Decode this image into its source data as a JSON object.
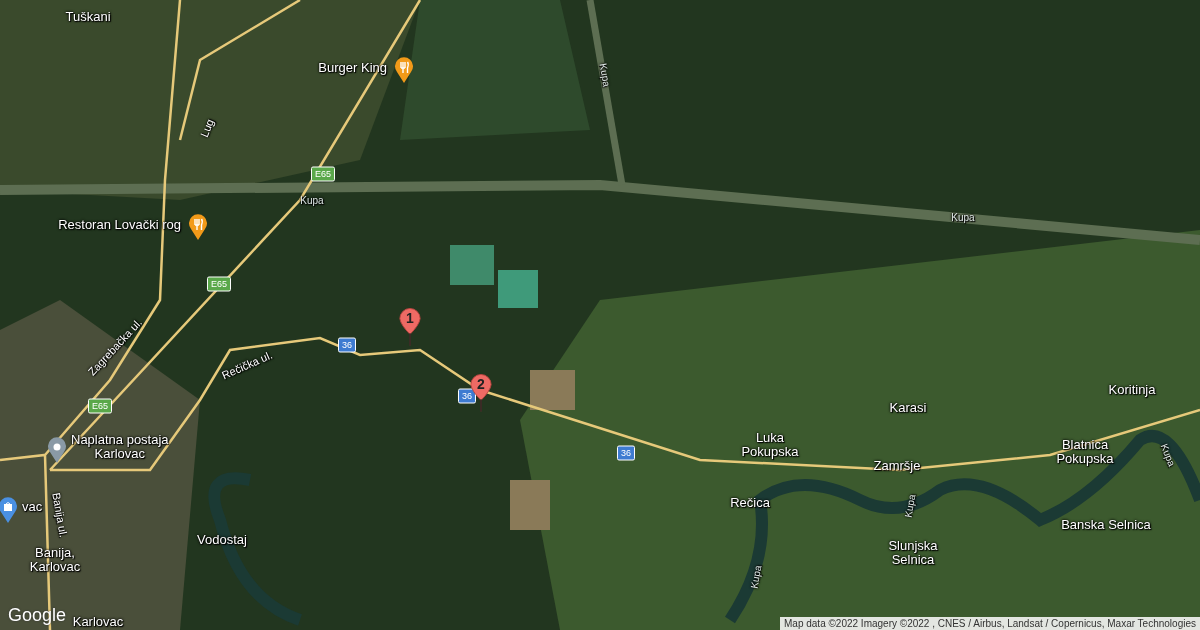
{
  "map": {
    "places": [
      {
        "kind": "town",
        "name": "Tuškani"
      },
      {
        "kind": "restaurant",
        "name": "Burger King"
      },
      {
        "kind": "restaurant",
        "name": "Restoran Lovački rog"
      },
      {
        "kind": "town",
        "name": "Koritinja"
      },
      {
        "kind": "town",
        "name": "Karasi"
      },
      {
        "kind": "landmark",
        "name": "Naplatna postaja\nKarlovac"
      },
      {
        "kind": "town",
        "name": "Luka\nPokupska"
      },
      {
        "kind": "town",
        "name": "Blatnica\nPokupska"
      },
      {
        "kind": "town",
        "name": "Zamršje"
      },
      {
        "kind": "town",
        "name": "Rečica"
      },
      {
        "kind": "shopping",
        "name": "vac"
      },
      {
        "kind": "town",
        "name": "Banska Selnica"
      },
      {
        "kind": "town",
        "name": "Vodostaj"
      },
      {
        "kind": "town",
        "name": "Slunjska\nSelnica"
      },
      {
        "kind": "town",
        "name": "Banija,\nKarlovac"
      },
      {
        "kind": "town",
        "name": "Karlovac"
      }
    ],
    "feature_labels": [
      {
        "kind": "river",
        "name": "Kupa"
      },
      {
        "kind": "river",
        "name": "Kupa"
      },
      {
        "kind": "river",
        "name": "Kupa"
      },
      {
        "kind": "river",
        "name": "Kupa"
      },
      {
        "kind": "river",
        "name": "Kupa"
      },
      {
        "kind": "river",
        "name": "Kupa"
      },
      {
        "kind": "street",
        "name": "Lug"
      },
      {
        "kind": "street",
        "name": "Zagrebačka ul."
      },
      {
        "kind": "street",
        "name": "Rečička ul."
      },
      {
        "kind": "street",
        "name": "Banija ul."
      }
    ],
    "shields": [
      {
        "kind": "european",
        "label": "E65"
      },
      {
        "kind": "european",
        "label": "E65"
      },
      {
        "kind": "european",
        "label": "E65"
      },
      {
        "kind": "national",
        "label": "36"
      },
      {
        "kind": "national",
        "label": "36"
      },
      {
        "kind": "national",
        "label": "36"
      }
    ],
    "markers": [
      {
        "label": "1"
      },
      {
        "label": "2"
      }
    ],
    "logo": "Google",
    "attribution": "Map data ©2022 Imagery ©2022 , CNES / Airbus, Landsat / Copernicus, Maxar Technologies"
  }
}
